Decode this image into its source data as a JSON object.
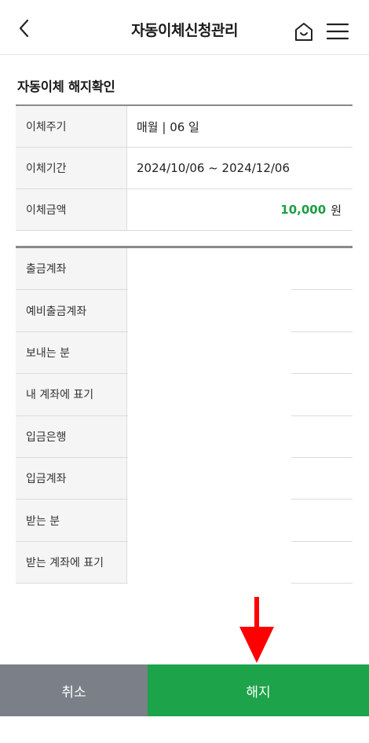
{
  "header": {
    "title": "자동이체신청관리",
    "back_icon": "back-chevron-icon",
    "home_icon": "home-icon",
    "menu_icon": "hamburger-menu-icon"
  },
  "section": {
    "title": "자동이체 해지확인"
  },
  "summary": {
    "cycle_label": "이체주기",
    "cycle_value": "매월 | 06 일",
    "period_label": "이체기간",
    "period_value": "2024/10/06 ~ 2024/12/06",
    "amount_label": "이체금액",
    "amount_value": "10,000",
    "amount_unit": "원"
  },
  "details": {
    "rows": [
      {
        "label": "출금계좌",
        "value": ""
      },
      {
        "label": "예비출금계좌",
        "value": ""
      },
      {
        "label": "보내는 분",
        "value": ""
      },
      {
        "label": "내 계좌에 표기",
        "value": ""
      },
      {
        "label": "입금은행",
        "value": ""
      },
      {
        "label": "입금계좌",
        "value": ""
      },
      {
        "label": "받는 분",
        "value": ""
      },
      {
        "label": "받는 계좌에 표기",
        "value": ""
      }
    ]
  },
  "buttons": {
    "cancel_label": "취소",
    "confirm_label": "해지"
  },
  "colors": {
    "accent_green": "#1da34a",
    "amount_green": "#1c9e44",
    "cancel_gray": "#7b7f88",
    "annotation_red": "#ff0000"
  }
}
